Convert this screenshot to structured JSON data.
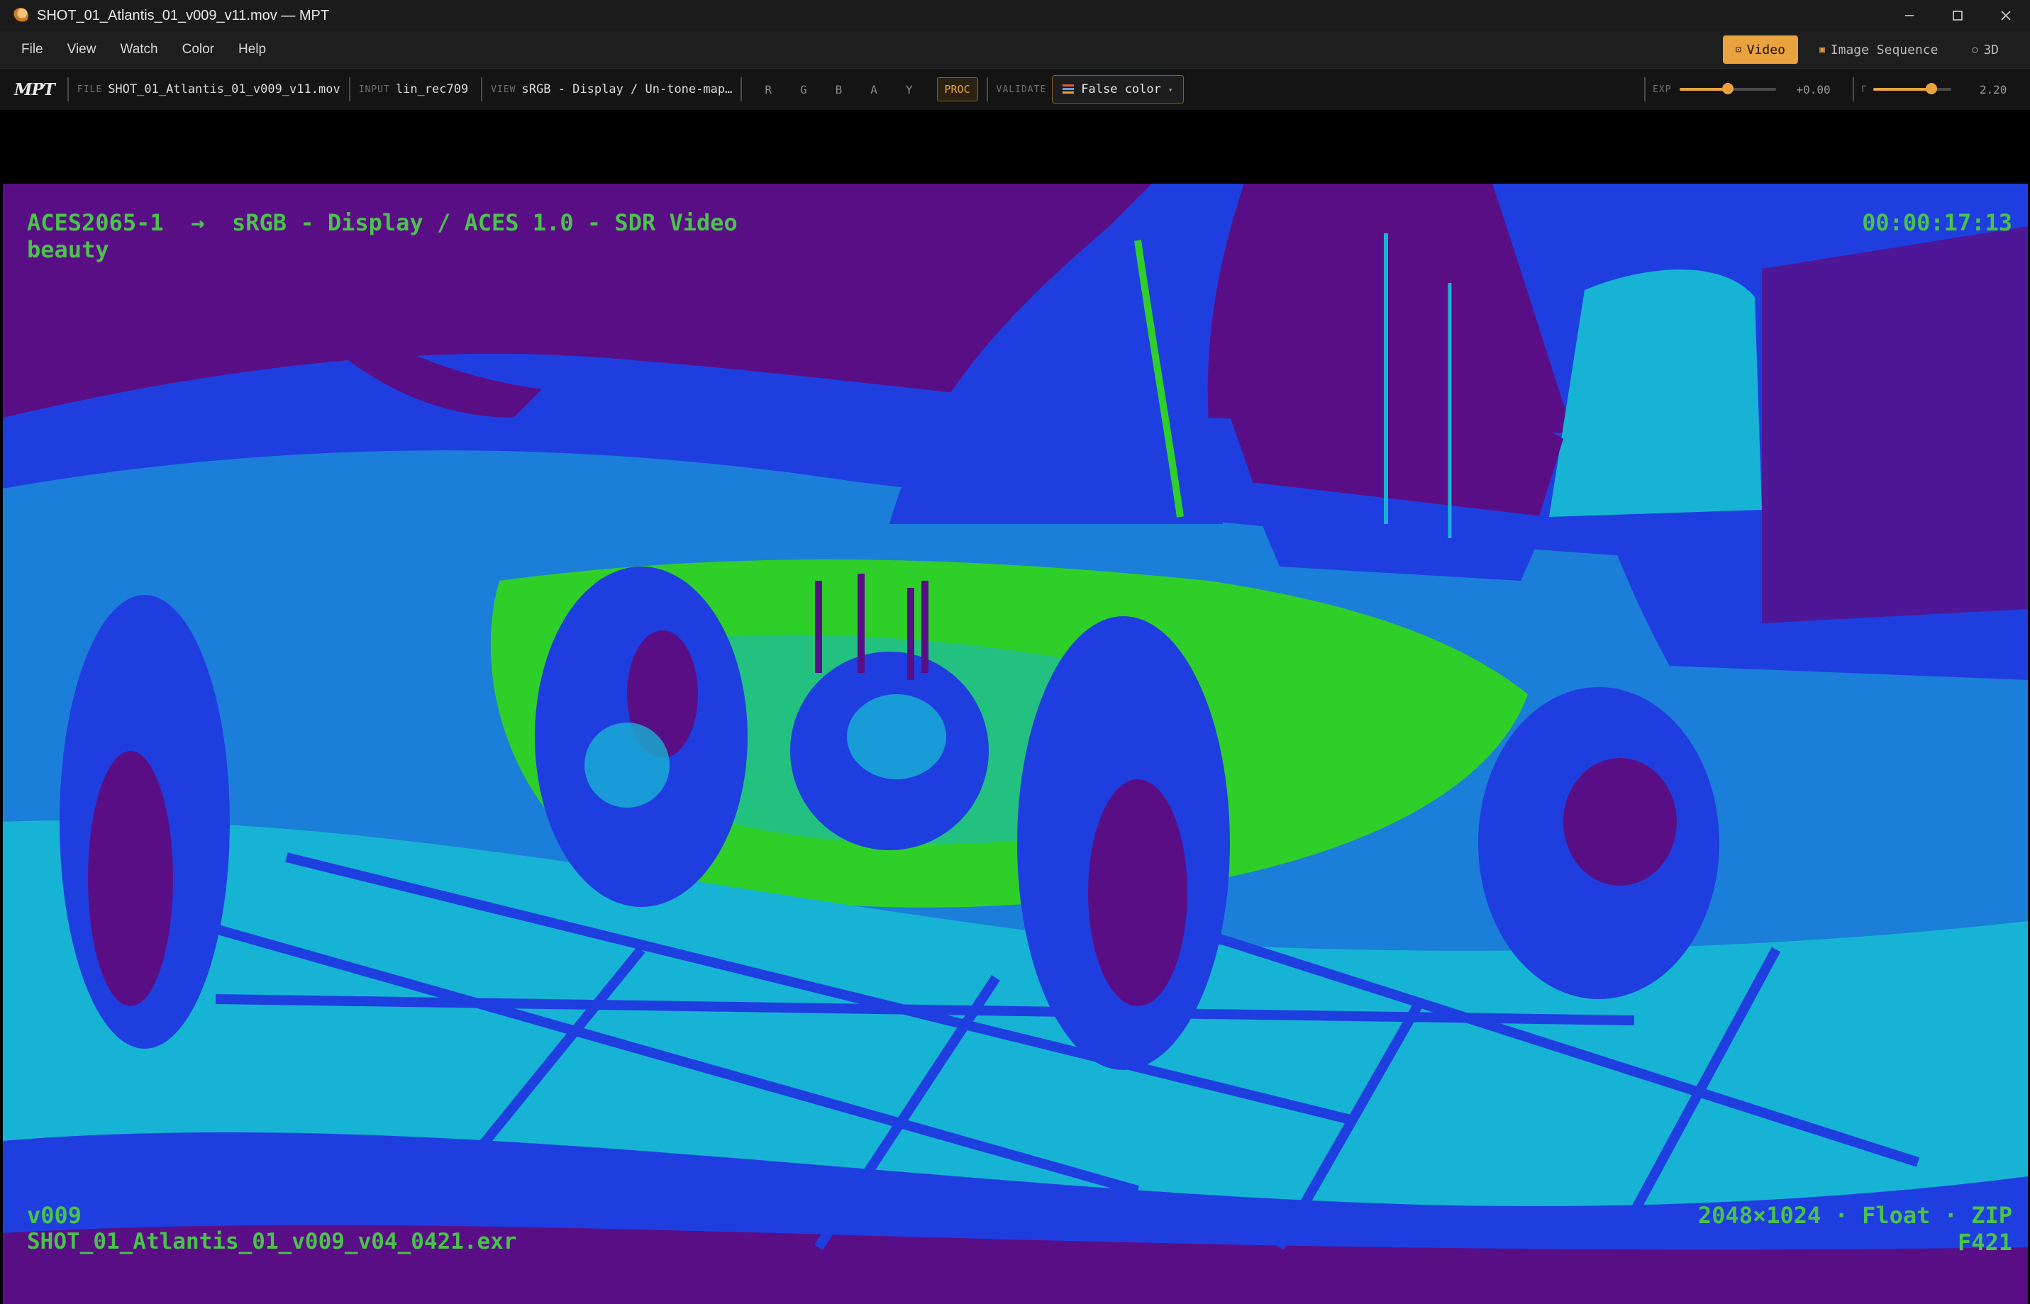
{
  "window": {
    "title": "SHOT_01_Atlantis_01_v009_v11.mov — MPT"
  },
  "menu": [
    "File",
    "View",
    "Watch",
    "Color",
    "Help"
  ],
  "modes": [
    {
      "label": "Video",
      "icon": "video-icon",
      "active": true
    },
    {
      "label": "Image Sequence",
      "icon": "image-sequence-icon",
      "active": false
    },
    {
      "label": "3D",
      "icon": "3d-icon",
      "active": false
    }
  ],
  "toolbar": {
    "logo": "MPT",
    "file_label": "FILE",
    "file_value": "SHOT_01_Atlantis_01_v009_v11.mov",
    "input_label": "INPUT",
    "input_value": "lin_rec709",
    "view_label": "VIEW",
    "view_value": "sRGB - Display / Un-tone-map…",
    "channels": [
      "R",
      "G",
      "B",
      "A",
      "Y"
    ],
    "proc_label": "PROC",
    "validate_label": "VALIDATE",
    "false_color_label": "False color",
    "false_color_swatch": [
      "#e25b3a",
      "#5aa0e0",
      "#e8a33f"
    ],
    "exposure_label": "EXP",
    "exposure_value": "+0.00",
    "exposure_level": 0.5,
    "gamma_label": "Γ",
    "gamma_value": "2.20",
    "gamma_level": 0.75,
    "accent_color": "#e8a33f"
  },
  "viewer": {
    "transform_line": "ACES2065-1  →  sRGB - Display / ACES 1.0 - SDR Video",
    "layer": "beauty",
    "timecode": "00:00:17:13",
    "version": "v009",
    "frame_filename": "SHOT_01_Atlantis_01_v009_v04_0421.exr",
    "format": "2048×1024 · Float · ZIP",
    "frame_number": "F421",
    "overlay_color": "#49c34a",
    "false_color_palette": [
      "#5a0e86",
      "#1f3ee0",
      "#17b3d4",
      "#2fcf2a"
    ]
  }
}
